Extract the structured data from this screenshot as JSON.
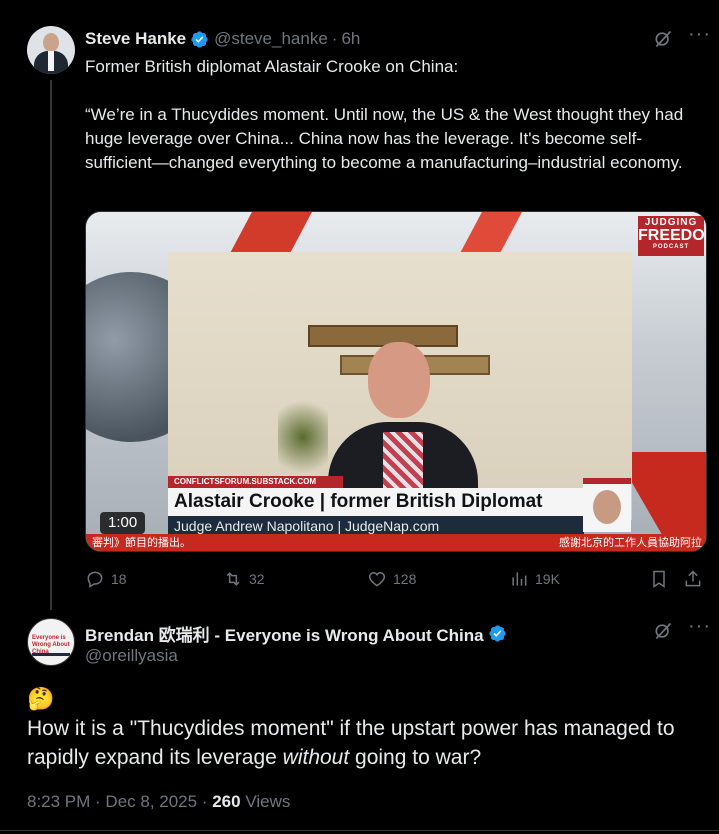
{
  "tweet1": {
    "author_name": "Steve Hanke",
    "handle": "@steve_hanke",
    "time": "6h",
    "text_line1": "Former British diplomat Alastair Crooke on China:",
    "text_quote": "“We’re in a Thucydides moment. Until now, the US & the West thought they had huge leverage over China... China now has the leverage. It's become self-sufficient—changed everything to become a manufacturing–industrial economy.",
    "video": {
      "duration": "1:00",
      "show_logo_line1": "JUDGING",
      "show_logo_line2": "FREEDOM",
      "show_logo_line3": "PODCAST",
      "source_url": "CONFLICTSFORUM.SUBSTACK.COM",
      "guest_caption": "Alastair Crooke | former British Diplomat",
      "host_caption": "Judge Andrew Napolitano | JudgeNap.com",
      "ticker_left": "審判》節目的播出。",
      "ticker_right": "感謝北京的工作人員協助阿拉"
    },
    "stats": {
      "replies": "18",
      "reposts": "32",
      "likes": "128",
      "views": "19K"
    }
  },
  "tweet2": {
    "author_name": "Brendan 欧瑞利 - Everyone is Wrong About China",
    "handle": "@oreillyasia",
    "avatar_text": "Everyone is Wrong About China",
    "emoji": "🤔",
    "text_before": "How it is a \"Thucydides moment\" if the upstart power has managed to rapidly expand its leverage ",
    "text_italic": "without",
    "text_after": " going to war?",
    "timestamp": "8:23 PM · Dec 8, 2025",
    "views_count": "260",
    "views_label": "Views"
  },
  "colors": {
    "background": "#000000",
    "text": "#e7e9ea",
    "muted": "#71767b",
    "verified": "#1d9bf0",
    "accent_red": "#b3262b"
  },
  "icons": [
    "verified-badge-icon",
    "grok-icon",
    "more-icon",
    "reply-icon",
    "repost-icon",
    "like-icon",
    "views-icon",
    "bookmark-icon",
    "share-icon"
  ]
}
